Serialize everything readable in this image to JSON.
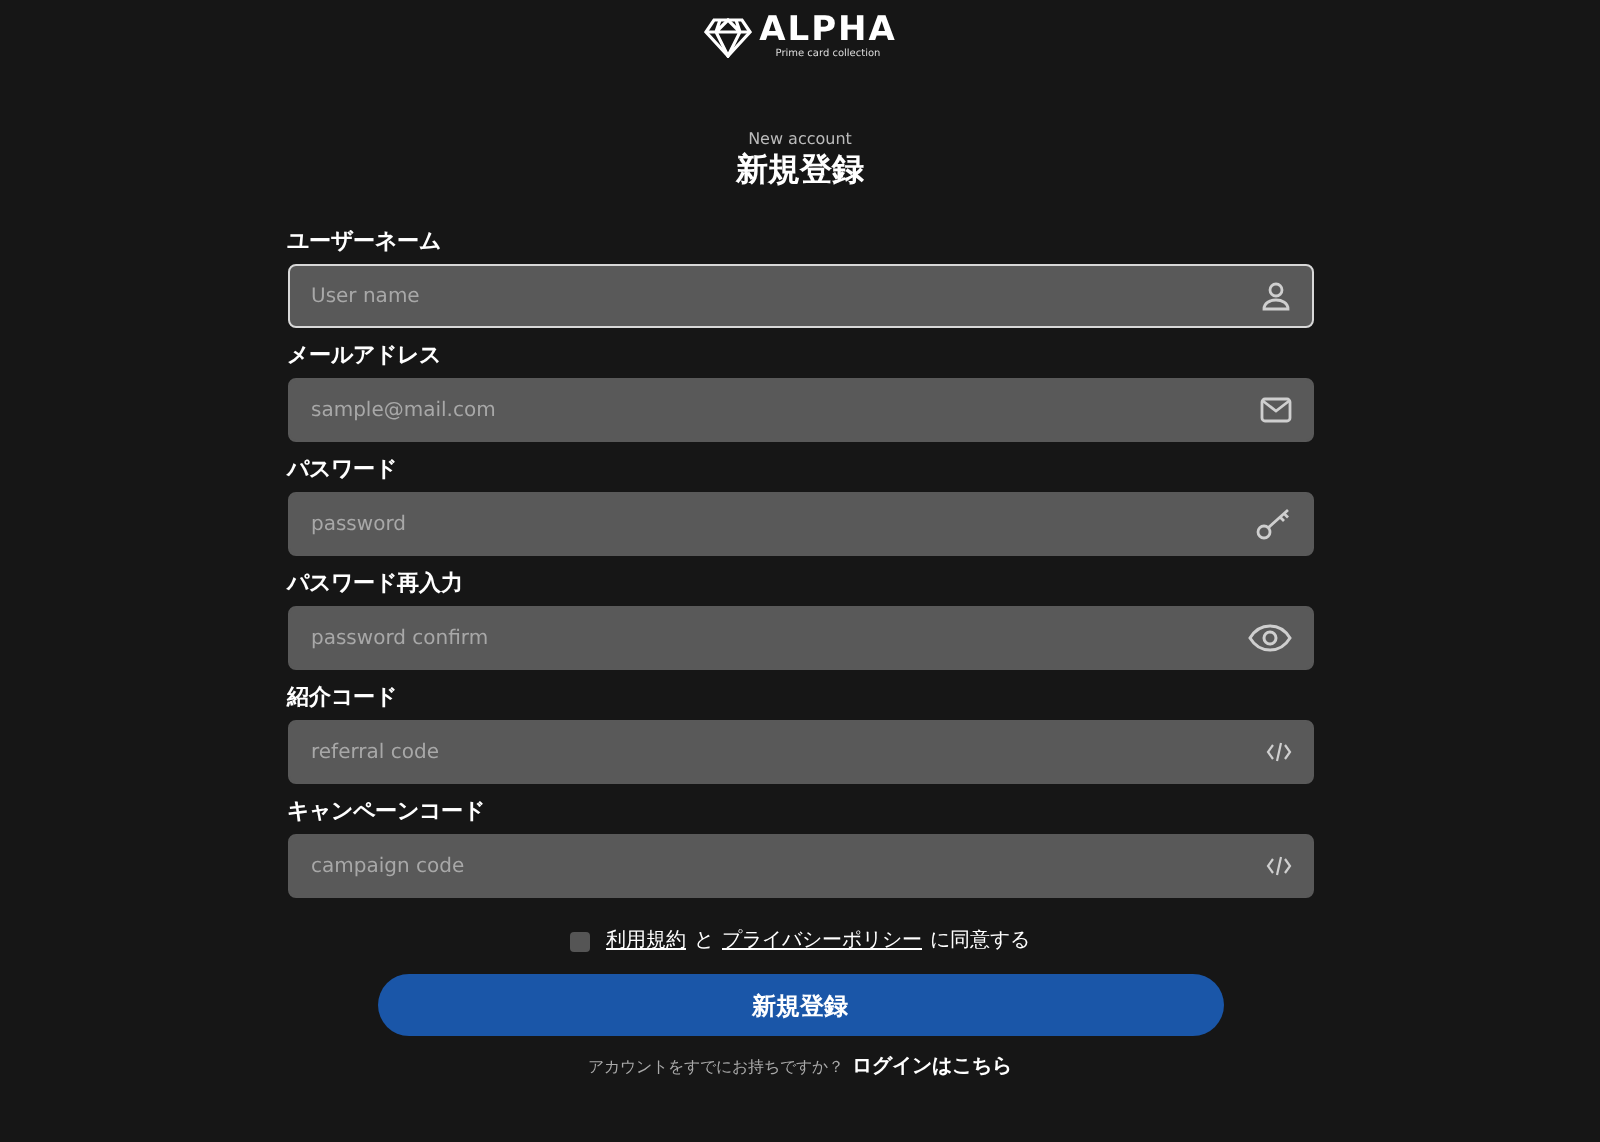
{
  "logo": {
    "name": "ALPHA",
    "tagline": "Prime card collection"
  },
  "heading": {
    "eyebrow": "New account",
    "title": "新規登録"
  },
  "fields": [
    {
      "label": "ユーザーネーム",
      "placeholder": "User name",
      "kind": "user",
      "focused": true
    },
    {
      "label": "メールアドレス",
      "placeholder": "sample@mail.com",
      "kind": "mail",
      "focused": false
    },
    {
      "label": "パスワード",
      "placeholder": "password",
      "kind": "key",
      "focused": false
    },
    {
      "label": "パスワード再入力",
      "placeholder": "password confirm",
      "kind": "eye",
      "focused": false
    },
    {
      "label": "紹介コード",
      "placeholder": "referral code",
      "kind": "code",
      "focused": false
    },
    {
      "label": "キャンペーンコード",
      "placeholder": "campaign code",
      "kind": "code",
      "focused": false
    }
  ],
  "agreement": {
    "checked": false,
    "terms_link": "利用規約",
    "connector": "と",
    "privacy_link": "プライバシーポリシー",
    "suffix": "に同意する"
  },
  "submit": "新規登録",
  "login_prompt": {
    "text": "アカウントをすでにお持ちですか？",
    "link": "ログインはこちら"
  }
}
